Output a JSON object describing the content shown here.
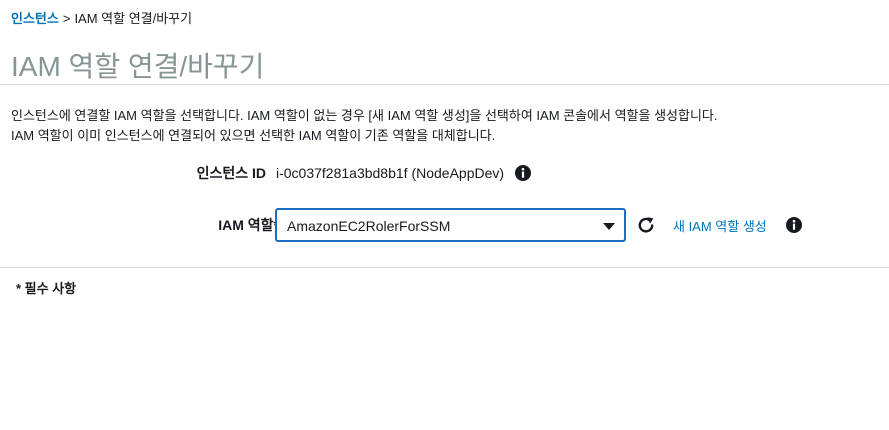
{
  "breadcrumb": {
    "parent": "인스턴스",
    "separator": ">",
    "current": "IAM 역할 연결/바꾸기"
  },
  "page": {
    "title": "IAM 역할 연결/바꾸기"
  },
  "description": {
    "line1": "인스턴스에 연결할 IAM 역할을 선택합니다. IAM 역할이 없는 경우 [새 IAM 역할 생성]을 선택하여 IAM 콘솔에서 역할을 생성합니다.",
    "line2": "IAM 역할이 이미 인스턴스에 연결되어 있으면 선택한 IAM 역할이 기존 역할을 대체합니다."
  },
  "form": {
    "instance_id_label": "인스턴스 ID",
    "instance_id_value": "i-0c037f281a3bd8b1f (NodeAppDev)",
    "iam_role_label": "IAM 역할*",
    "iam_role_selected": "AmazonEC2RolerForSSM",
    "create_role_link": "새 IAM 역할 생성"
  },
  "footer": {
    "required_note": "* 필수 사항"
  },
  "icons": {
    "instance_info": "info-circle-icon",
    "role_info": "info-circle-icon",
    "refresh": "refresh-icon",
    "dropdown": "caret-down-icon"
  },
  "colors": {
    "link": "#0073bb",
    "title": "#879596",
    "focus_border": "#1a6fbf",
    "divider": "#d5dbdb",
    "text": "#16191f"
  }
}
